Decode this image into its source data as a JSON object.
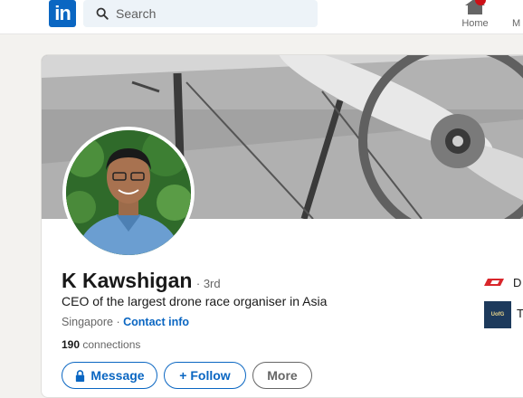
{
  "topbar": {
    "logo_text": "in",
    "search_placeholder": "Search",
    "nav": [
      {
        "label": "Home",
        "icon": "home-icon"
      },
      {
        "label": "M"
      }
    ]
  },
  "profile": {
    "name": "K Kawshigan",
    "degree": "· 3rd",
    "headline": "CEO of the largest drone race organiser in Asia",
    "location": "Singapore",
    "separator": " · ",
    "contact_info": "Contact info",
    "connections_count": "190",
    "connections_label": " connections"
  },
  "actions": {
    "message": "Message",
    "follow": "+ Follow",
    "more": "More"
  },
  "experience": [
    {
      "label": "D",
      "logo": "red-chevron-logo"
    },
    {
      "label": "T",
      "logo": "university-logo",
      "logo_text": "UofG"
    }
  ],
  "colors": {
    "brand": "#0a66c2",
    "badge": "#cc1016",
    "page_bg": "#f3f2ef"
  }
}
